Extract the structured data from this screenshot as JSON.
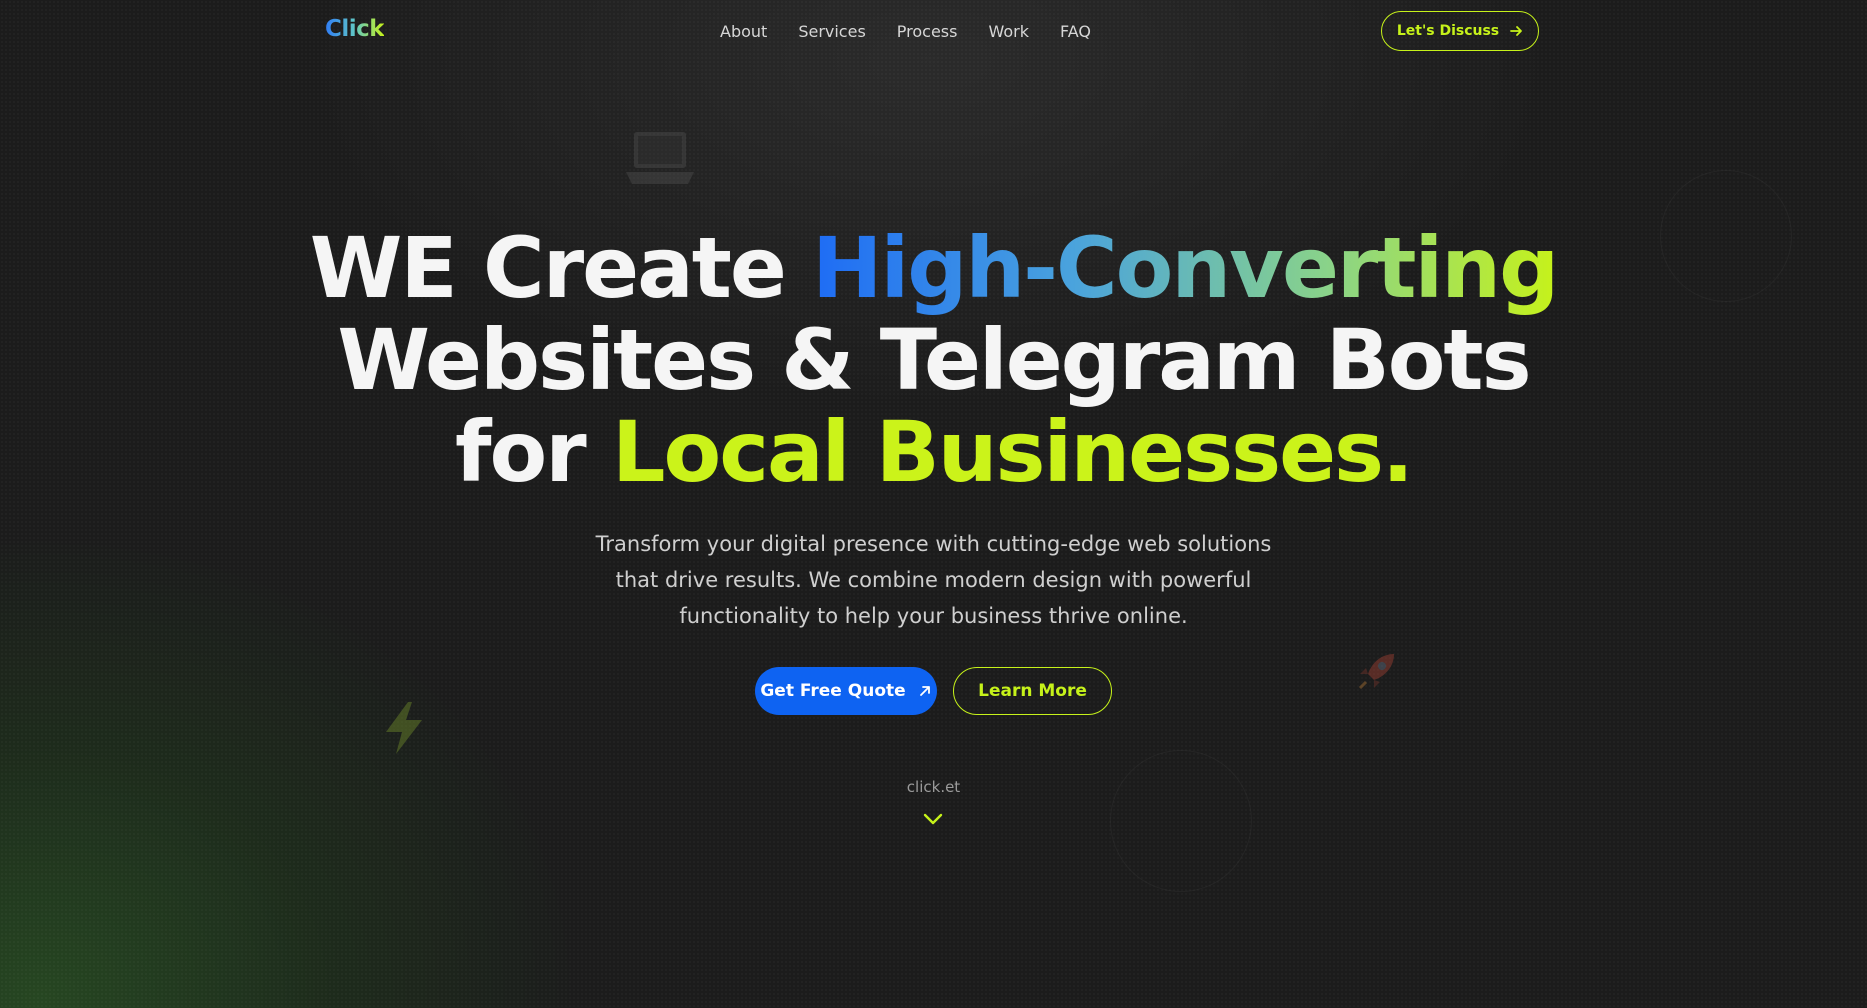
{
  "nav": {
    "logo": "Click",
    "links": [
      "About",
      "Services",
      "Process",
      "Work",
      "FAQ"
    ],
    "cta_label": "Let's Discuss"
  },
  "hero": {
    "line1_plain": "WE Create ",
    "line1_highlight": "High-Converting",
    "line2": "Websites & Telegram Bots",
    "line3_plain": "for ",
    "line3_highlight": "Local Businesses.",
    "subtitle_lines": [
      "Transform your digital presence with cutting-edge web solutions",
      "that drive results. We combine modern design with powerful",
      "functionality to help your business thrive online."
    ],
    "primary_button": "Get Free Quote",
    "secondary_button": "Learn More",
    "domain_text": "click.et"
  },
  "icons": {
    "cta_arrow": "arrow-right-icon",
    "quote_arrow": "arrow-up-right-icon",
    "scroll": "chevron-down-icon",
    "decor": [
      "laptop-icon",
      "lightning-icon",
      "rocket-icon"
    ]
  },
  "colors": {
    "accent_lime": "#c6f21a",
    "accent_blue": "#0e63f2",
    "background": "#1c1c1c"
  }
}
